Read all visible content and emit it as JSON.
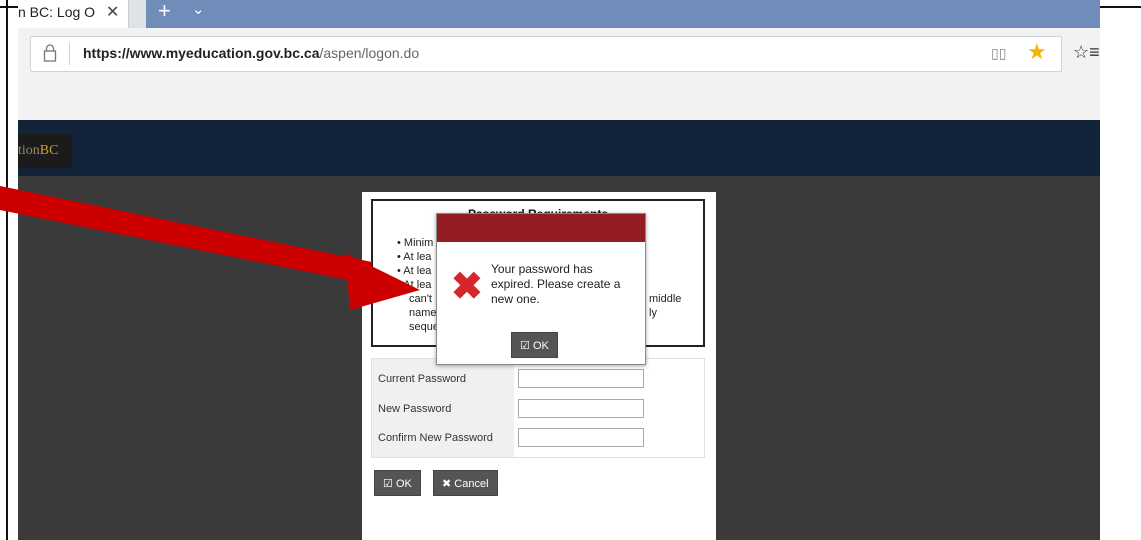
{
  "browser": {
    "tab_title": "n BC: Log O",
    "tab_close": "✕",
    "new_tab": "+",
    "tab_menu": "⌄",
    "url_domain": "https://www.myeducation.gov.bc.ca",
    "url_path": "/aspen/logon.do",
    "icons": [
      "lock-icon",
      "reader-icon",
      "star-icon",
      "favorites-icon"
    ]
  },
  "site": {
    "logo_text": "tion",
    "logo_accent": "BC"
  },
  "requirements": {
    "title": "Password Requirements",
    "lines": [
      "• Minim",
      "• At lea",
      "• At lea",
      "• At lea",
      "can't",
      "name",
      "seque",
      "middle",
      "ly"
    ]
  },
  "form": {
    "current_password_label": "Current Password",
    "new_password_label": "New Password",
    "confirm_password_label": "Confirm New Password",
    "current_password_value": "",
    "new_password_value": "",
    "confirm_password_value": "",
    "ok_label": "OK",
    "cancel_label": "Cancel"
  },
  "modal": {
    "message": "Your password has expired. Please create a new one.",
    "ok_label": "OK"
  },
  "colors": {
    "modal_header": "#941d22",
    "error_icon": "#d7262b",
    "site_header": "#13243a",
    "arrow": "#cc0000"
  }
}
